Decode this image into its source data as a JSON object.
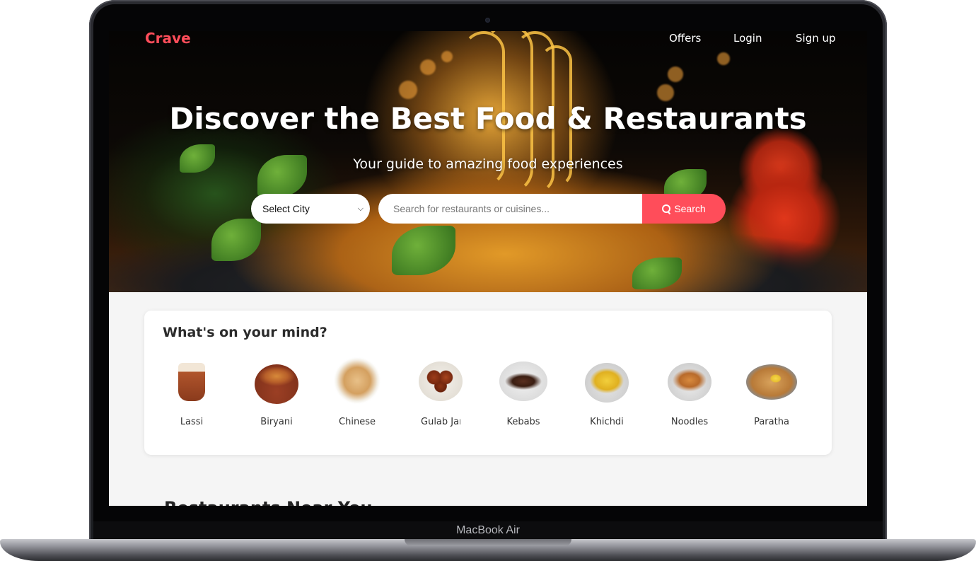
{
  "device": {
    "label": "MacBook Air"
  },
  "nav": {
    "logo": "Crave",
    "links": [
      "Offers",
      "Login",
      "Sign up"
    ]
  },
  "hero": {
    "title": "Discover the Best Food & Restaurants",
    "subtitle": "Your guide to amazing food experiences"
  },
  "search": {
    "city_selected": "Select City",
    "placeholder": "Search for restaurants or cuisines...",
    "button_label": "Search"
  },
  "categories": {
    "title": "What's on your mind?",
    "items": [
      {
        "label": "Lassi"
      },
      {
        "label": "Biryani"
      },
      {
        "label": "Chinese"
      },
      {
        "label": "Gulab Jamun"
      },
      {
        "label": "Kebabs"
      },
      {
        "label": "Khichdi"
      },
      {
        "label": "Noodles"
      },
      {
        "label": "Paratha"
      }
    ]
  },
  "next_section": {
    "title": "Restaurants Near You"
  },
  "colors": {
    "accent": "#ff4d5a",
    "page_bg": "#f5f5f5",
    "card_bg": "#ffffff"
  }
}
